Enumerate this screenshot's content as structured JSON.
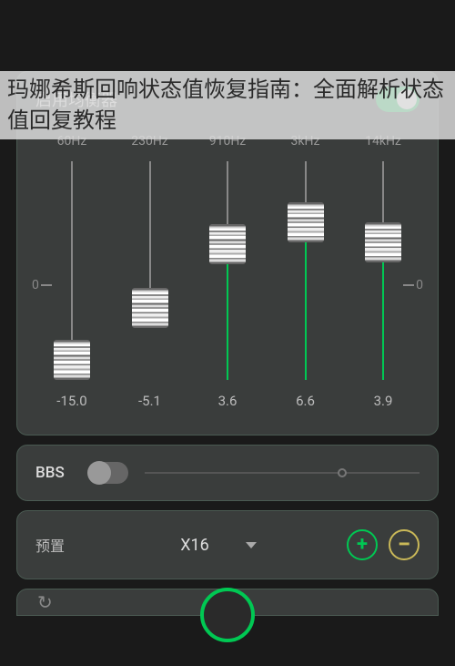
{
  "title": "玛娜希斯回响状态值恢复指南：全面解析状态值回复教程",
  "equalizer": {
    "title": "启用均衡器",
    "enabled": true,
    "midline_left": "0",
    "midline_right": "0",
    "bands": [
      {
        "freq": "60Hz",
        "value": "-15.0",
        "position": 0.0
      },
      {
        "freq": "230Hz",
        "value": "-5.1",
        "position": 0.33
      },
      {
        "freq": "910Hz",
        "value": "3.6",
        "position": 0.62
      },
      {
        "freq": "3kHz",
        "value": "6.6",
        "position": 0.72
      },
      {
        "freq": "14kHz",
        "value": "3.9",
        "position": 0.63
      }
    ]
  },
  "bbs": {
    "label": "BBS",
    "enabled": false
  },
  "preset": {
    "label": "预置",
    "selected": "X16"
  }
}
